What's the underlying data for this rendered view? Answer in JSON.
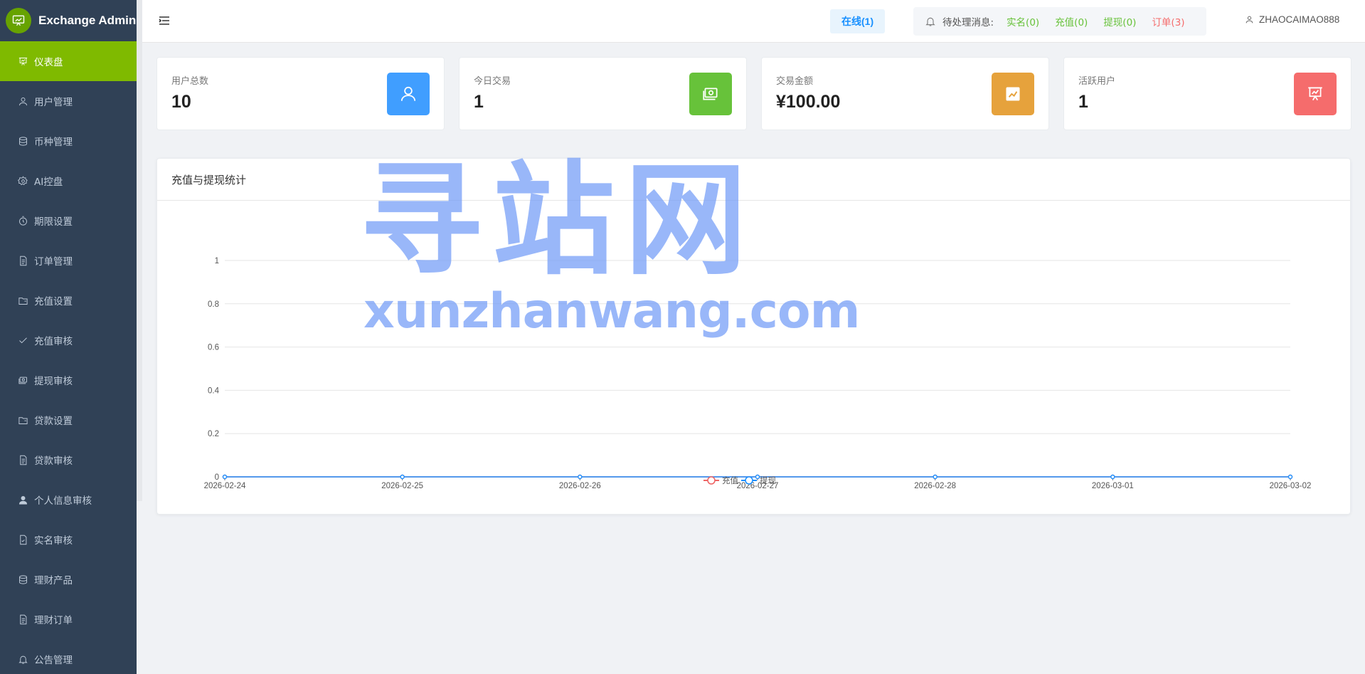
{
  "brand": {
    "title": "Exchange Admin"
  },
  "sidebar": {
    "items": [
      {
        "label": "仪表盘",
        "icon": "dashboard-icon",
        "active": true
      },
      {
        "label": "用户管理",
        "icon": "user-icon"
      },
      {
        "label": "币种管理",
        "icon": "database-icon"
      },
      {
        "label": "AI控盘",
        "icon": "gear-icon"
      },
      {
        "label": "期限设置",
        "icon": "timer-icon"
      },
      {
        "label": "订单管理",
        "icon": "document-icon"
      },
      {
        "label": "充值设置",
        "icon": "folder-icon"
      },
      {
        "label": "充值审核",
        "icon": "check-icon"
      },
      {
        "label": "提现审核",
        "icon": "money-icon"
      },
      {
        "label": "贷款设置",
        "icon": "folder-icon"
      },
      {
        "label": "贷款审核",
        "icon": "document-icon"
      },
      {
        "label": "个人信息审核",
        "icon": "person-icon"
      },
      {
        "label": "实名审核",
        "icon": "document-check-icon"
      },
      {
        "label": "理财产品",
        "icon": "database-icon"
      },
      {
        "label": "理财订单",
        "icon": "document-icon"
      },
      {
        "label": "公告管理",
        "icon": "bell-icon"
      }
    ]
  },
  "header": {
    "online": "在线(1)",
    "pending_label": "待处理消息:",
    "pending_realname": "实名(0)",
    "pending_recharge": "充值(0)",
    "pending_withdraw": "提现(0)",
    "pending_orders": "订单(3)",
    "username": "ZHAOCAIMAO888"
  },
  "stats": [
    {
      "label": "用户总数",
      "value": "10",
      "icon": "user-icon",
      "color": "#409eff"
    },
    {
      "label": "今日交易",
      "value": "1",
      "icon": "money-icon",
      "color": "#67c23a"
    },
    {
      "label": "交易金额",
      "value": "¥100.00",
      "icon": "trend-icon",
      "color": "#e6a23c"
    },
    {
      "label": "活跃用户",
      "value": "1",
      "icon": "presentation-icon",
      "color": "#f56c6c"
    }
  ],
  "chart_panel": {
    "title": "充值与提现统计"
  },
  "chart_data": {
    "type": "line",
    "categories": [
      "2026-02-24",
      "2026-02-25",
      "2026-02-26",
      "2026-02-27",
      "2026-02-28",
      "2026-03-01",
      "2026-03-02"
    ],
    "series": [
      {
        "name": "充值",
        "values": [
          0,
          0,
          0,
          0,
          0,
          0,
          0
        ],
        "color": "#ee6666"
      },
      {
        "name": "提现",
        "values": [
          0,
          0,
          0,
          0,
          0,
          0,
          0
        ],
        "color": "#1e90ff"
      }
    ],
    "yticks": [
      "0",
      "0.2",
      "0.4",
      "0.6",
      "0.8",
      "1"
    ],
    "ylim": [
      0,
      1
    ],
    "grid": true,
    "legend": "bottom-center"
  },
  "watermark": {
    "cn": "寻站网",
    "en": "xunzhanwang.com"
  }
}
